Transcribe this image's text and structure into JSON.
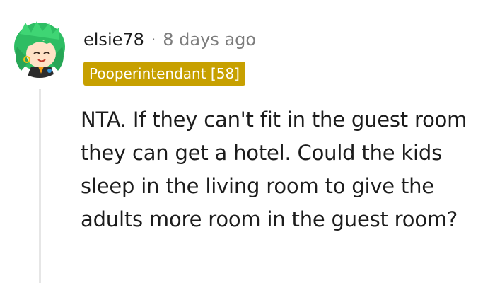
{
  "comment": {
    "author": "elsie78",
    "separator": "·",
    "timestamp": "8 days ago",
    "flair": "Pooperintendant [58]",
    "text": "NTA. If they can't fit in the guest room they can get a hotel. Could the kids sleep in the living room to give the adults more room in the guest room?"
  },
  "colors": {
    "flair_background": "#c7a000",
    "avatar_hair": "#2ebd63",
    "thread_line": "#e6e6e6"
  },
  "icons": {
    "avatar": "avatar-green-hair-character"
  }
}
